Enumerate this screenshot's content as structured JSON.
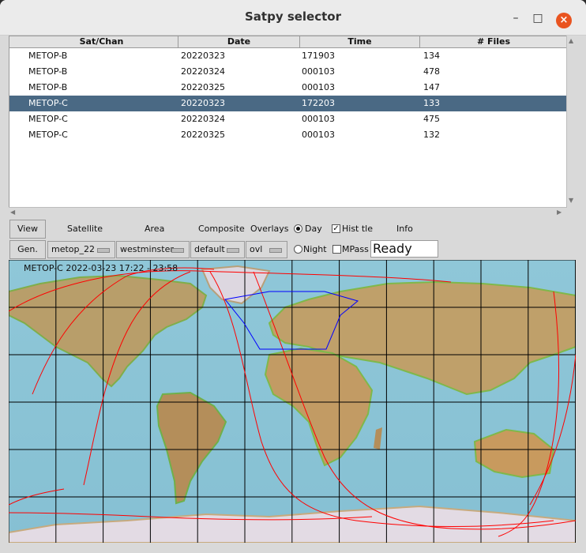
{
  "window": {
    "title": "Satpy selector"
  },
  "controls": {
    "minimize": "–",
    "maximize": "□",
    "close": "×"
  },
  "table": {
    "columns": [
      "Sat/Chan",
      "Date",
      "Time",
      "# Files"
    ],
    "rows": [
      [
        "METOP-B",
        "20220323",
        "171903",
        "134"
      ],
      [
        "METOP-B",
        "20220324",
        "000103",
        "478"
      ],
      [
        "METOP-B",
        "20220325",
        "000103",
        "147"
      ],
      [
        "METOP-C",
        "20220323",
        "172203",
        "133"
      ],
      [
        "METOP-C",
        "20220324",
        "000103",
        "475"
      ],
      [
        "METOP-C",
        "20220325",
        "000103",
        "132"
      ]
    ],
    "selected_row": 3
  },
  "toolbar": {
    "view_label": "View",
    "gen_label": "Gen.",
    "satellite_label": "Satellite",
    "area_label": "Area",
    "composite_label": "Composite",
    "overlays_label": "Overlays",
    "info_label": "Info",
    "satellite_value": "metop_22",
    "area_value": "westminster",
    "composite_value": "default",
    "overlays_value": "ovl",
    "day_label": "Day",
    "night_label": "Night",
    "day_checked": true,
    "hist_label": "Hist tle",
    "hist_checked": true,
    "mpass_label": "MPass",
    "mpass_checked": false,
    "status": "Ready"
  },
  "map": {
    "caption": "METOP-C  2022-03-23  17:22 - 23:58",
    "track_color": "#ff0000",
    "area_color": "#0000ff",
    "grid_color": "#000000"
  }
}
